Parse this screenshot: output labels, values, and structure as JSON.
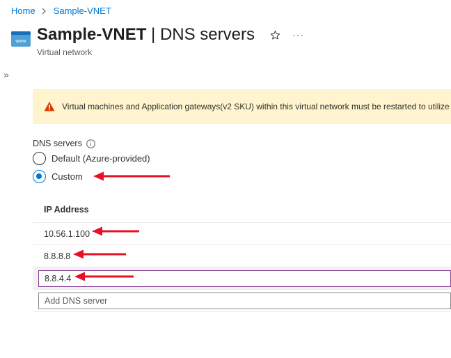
{
  "breadcrumb": {
    "home": "Home",
    "current": "Sample-VNET"
  },
  "header": {
    "title_bold": "Sample-VNET",
    "title_rest": "| DNS servers",
    "subtitle": "Virtual network",
    "resource_icon": "virtual-network-icon",
    "resource_icon_text": "www",
    "more": "···"
  },
  "sidebar": {
    "expand_glyph": "»"
  },
  "warning": {
    "text": "Virtual machines and Application gateways(v2 SKU) within this virtual network must be restarted to utilize",
    "icon": "warning-icon"
  },
  "dns": {
    "label": "DNS servers",
    "options": [
      {
        "label": "Default (Azure-provided)",
        "selected": false
      },
      {
        "label": "Custom",
        "selected": true
      }
    ]
  },
  "table": {
    "header": "IP Address",
    "rows": [
      "10.56.1.100",
      "8.8.8.8"
    ],
    "editing_value": "8.8.4.4",
    "add_placeholder": "Add DNS server"
  },
  "colors": {
    "accent": "#0078d4",
    "warning_bg": "#fff4ce",
    "warning_icon": "#d83b01",
    "annotation_arrow": "#e81123",
    "focus_border": "#8a3f9a"
  }
}
